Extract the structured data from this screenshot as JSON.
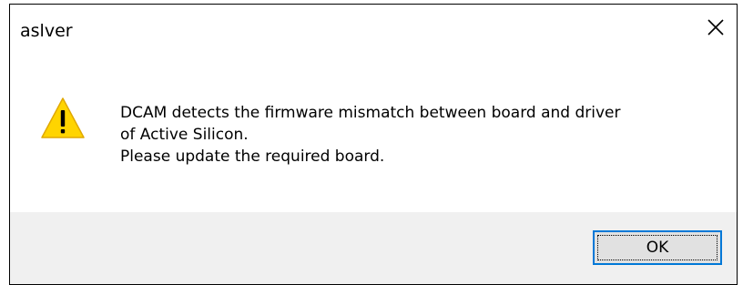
{
  "window": {
    "title": "aslver",
    "close_icon": "close-icon"
  },
  "message": {
    "icon": "warning-icon",
    "lines": [
      "DCAM detects the firmware mismatch between board and driver",
      "of Active Silicon.",
      "Please update the required board."
    ]
  },
  "buttons": {
    "ok_label": "OK"
  },
  "colors": {
    "accent": "#0078d7",
    "warning_fill": "#ffd400",
    "footer_bg": "#f0f0f0",
    "button_bg": "#e1e1e1"
  }
}
